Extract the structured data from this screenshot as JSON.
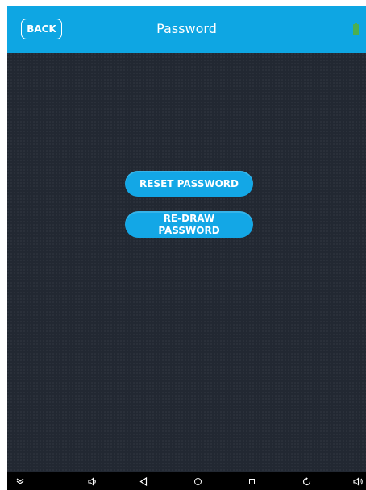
{
  "header": {
    "back_label": "BACK",
    "title": "Password",
    "accent_color": "#0ea6e3"
  },
  "main": {
    "buttons": [
      {
        "label": "RESET PASSWORD"
      },
      {
        "label_line1": "RE-DRAW",
        "label_line2": "PASSWORD"
      }
    ]
  },
  "navbar": {
    "icons": [
      "chevron-down-icon",
      "volume-down-icon",
      "back-icon",
      "home-icon",
      "recents-icon",
      "rotate-icon",
      "volume-up-icon"
    ]
  }
}
